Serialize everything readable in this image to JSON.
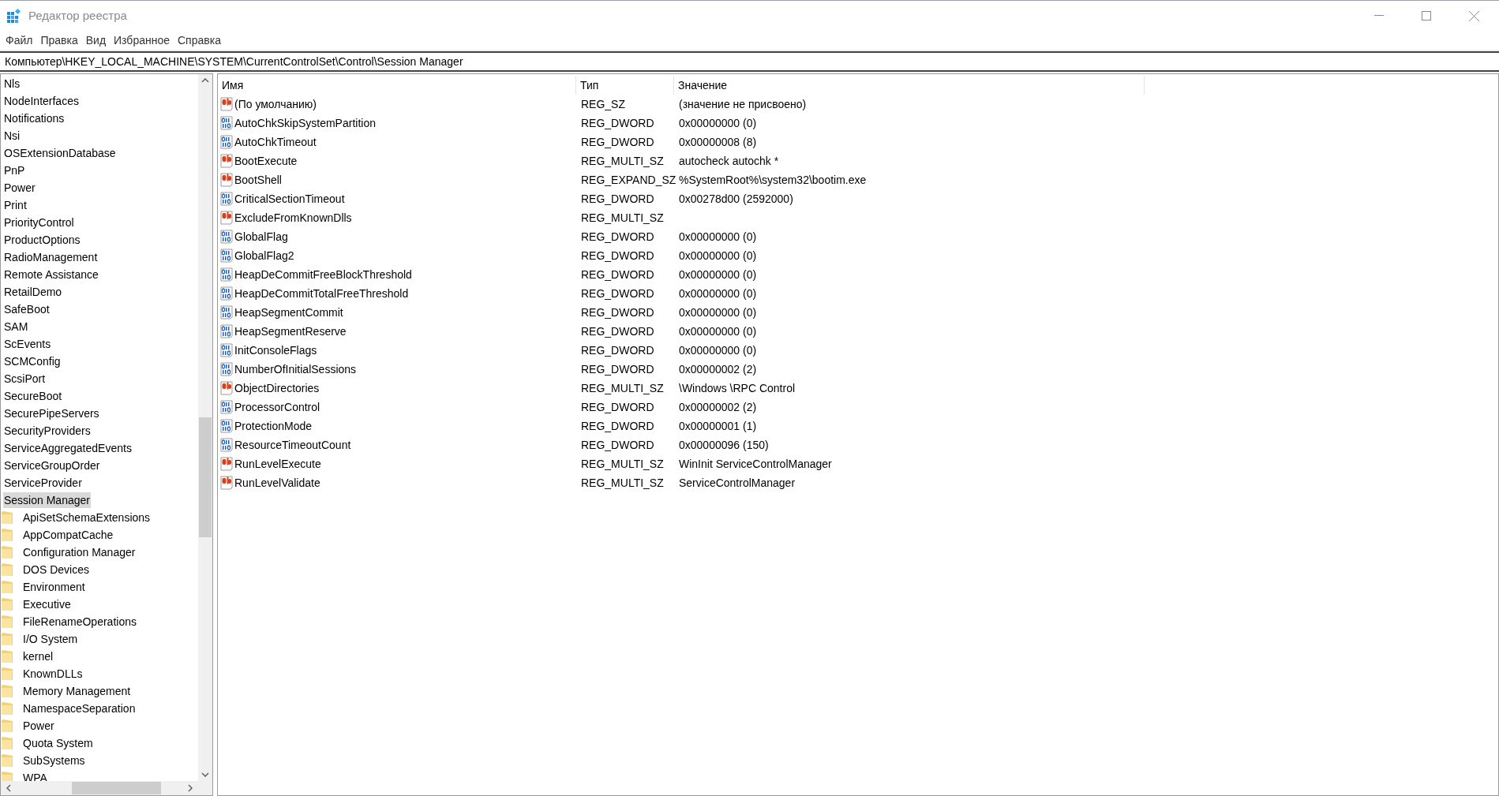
{
  "window": {
    "title": "Редактор реестра"
  },
  "menu": [
    "Файл",
    "Правка",
    "Вид",
    "Избранное",
    "Справка"
  ],
  "address": "Компьютер\\HKEY_LOCAL_MACHINE\\SYSTEM\\CurrentControlSet\\Control\\Session Manager",
  "tree": [
    {
      "label": "Nls",
      "selected": false
    },
    {
      "label": "NodeInterfaces",
      "selected": false
    },
    {
      "label": "Notifications",
      "selected": false
    },
    {
      "label": "Nsi",
      "selected": false
    },
    {
      "label": "OSExtensionDatabase",
      "selected": false
    },
    {
      "label": "PnP",
      "selected": false
    },
    {
      "label": "Power",
      "selected": false
    },
    {
      "label": "Print",
      "selected": false
    },
    {
      "label": "PriorityControl",
      "selected": false
    },
    {
      "label": "ProductOptions",
      "selected": false
    },
    {
      "label": "RadioManagement",
      "selected": false
    },
    {
      "label": "Remote Assistance",
      "selected": false
    },
    {
      "label": "RetailDemo",
      "selected": false
    },
    {
      "label": "SafeBoot",
      "selected": false
    },
    {
      "label": "SAM",
      "selected": false
    },
    {
      "label": "ScEvents",
      "selected": false
    },
    {
      "label": "SCMConfig",
      "selected": false
    },
    {
      "label": "ScsiPort",
      "selected": false
    },
    {
      "label": "SecureBoot",
      "selected": false
    },
    {
      "label": "SecurePipeServers",
      "selected": false
    },
    {
      "label": "SecurityProviders",
      "selected": false
    },
    {
      "label": "ServiceAggregatedEvents",
      "selected": false
    },
    {
      "label": "ServiceGroupOrder",
      "selected": false
    },
    {
      "label": "ServiceProvider",
      "selected": false
    },
    {
      "label": "Session Manager",
      "selected": true,
      "children": [
        {
          "label": "ApiSetSchemaExtensions",
          "selected": false
        },
        {
          "label": "AppCompatCache",
          "selected": false
        },
        {
          "label": "Configuration Manager",
          "selected": false
        },
        {
          "label": "DOS Devices",
          "selected": false
        },
        {
          "label": "Environment",
          "selected": false
        },
        {
          "label": "Executive",
          "selected": false
        },
        {
          "label": "FileRenameOperations",
          "selected": false
        },
        {
          "label": "I/O System",
          "selected": false
        },
        {
          "label": "kernel",
          "selected": false
        },
        {
          "label": "KnownDLLs",
          "selected": false
        },
        {
          "label": "Memory Management",
          "selected": false
        },
        {
          "label": "NamespaceSeparation",
          "selected": false
        },
        {
          "label": "Power",
          "selected": false
        },
        {
          "label": "Quota System",
          "selected": false
        },
        {
          "label": "SubSystems",
          "selected": false
        },
        {
          "label": "WPA",
          "selected": false
        }
      ]
    }
  ],
  "table": {
    "columns": [
      "Имя",
      "Тип",
      "Значение"
    ],
    "rows": [
      {
        "kind": "string",
        "name": "(По умолчанию)",
        "type": "REG_SZ",
        "value": "(значение не присвоено)"
      },
      {
        "kind": "number",
        "name": "AutoChkSkipSystemPartition",
        "type": "REG_DWORD",
        "value": "0x00000000 (0)"
      },
      {
        "kind": "number",
        "name": "AutoChkTimeout",
        "type": "REG_DWORD",
        "value": "0x00000008 (8)"
      },
      {
        "kind": "string",
        "name": "BootExecute",
        "type": "REG_MULTI_SZ",
        "value": "autocheck autochk *"
      },
      {
        "kind": "string",
        "name": "BootShell",
        "type": "REG_EXPAND_SZ",
        "value": "%SystemRoot%\\system32\\bootim.exe"
      },
      {
        "kind": "number",
        "name": "CriticalSectionTimeout",
        "type": "REG_DWORD",
        "value": "0x00278d00 (2592000)"
      },
      {
        "kind": "string",
        "name": "ExcludeFromKnownDlls",
        "type": "REG_MULTI_SZ"
      },
      {
        "kind": "number",
        "name": "GlobalFlag",
        "type": "REG_DWORD",
        "value": "0x00000000 (0)"
      },
      {
        "kind": "number",
        "name": "GlobalFlag2",
        "type": "REG_DWORD",
        "value": "0x00000000 (0)"
      },
      {
        "kind": "number",
        "name": "HeapDeCommitFreeBlockThreshold",
        "type": "REG_DWORD",
        "value": "0x00000000 (0)"
      },
      {
        "kind": "number",
        "name": "HeapDeCommitTotalFreeThreshold",
        "type": "REG_DWORD",
        "value": "0x00000000 (0)"
      },
      {
        "kind": "number",
        "name": "HeapSegmentCommit",
        "type": "REG_DWORD",
        "value": "0x00000000 (0)"
      },
      {
        "kind": "number",
        "name": "HeapSegmentReserve",
        "type": "REG_DWORD",
        "value": "0x00000000 (0)"
      },
      {
        "kind": "number",
        "name": "InitConsoleFlags",
        "type": "REG_DWORD",
        "value": "0x00000000 (0)"
      },
      {
        "kind": "number",
        "name": "NumberOfInitialSessions",
        "type": "REG_DWORD",
        "value": "0x00000002 (2)"
      },
      {
        "kind": "string",
        "name": "ObjectDirectories",
        "type": "REG_MULTI_SZ",
        "value": "\\Windows \\RPC Control"
      },
      {
        "kind": "number",
        "name": "ProcessorControl",
        "type": "REG_DWORD",
        "value": "0x00000002 (2)"
      },
      {
        "kind": "number",
        "name": "ProtectionMode",
        "type": "REG_DWORD",
        "value": "0x00000001 (1)"
      },
      {
        "kind": "number",
        "name": "ResourceTimeoutCount",
        "type": "REG_DWORD",
        "value": "0x00000096 (150)"
      },
      {
        "kind": "string",
        "name": "RunLevelExecute",
        "type": "REG_MULTI_SZ",
        "value": "WinInit ServiceControlManager"
      },
      {
        "kind": "string",
        "name": "RunLevelValidate",
        "type": "REG_MULTI_SZ",
        "value": "ServiceControlManager"
      }
    ]
  }
}
